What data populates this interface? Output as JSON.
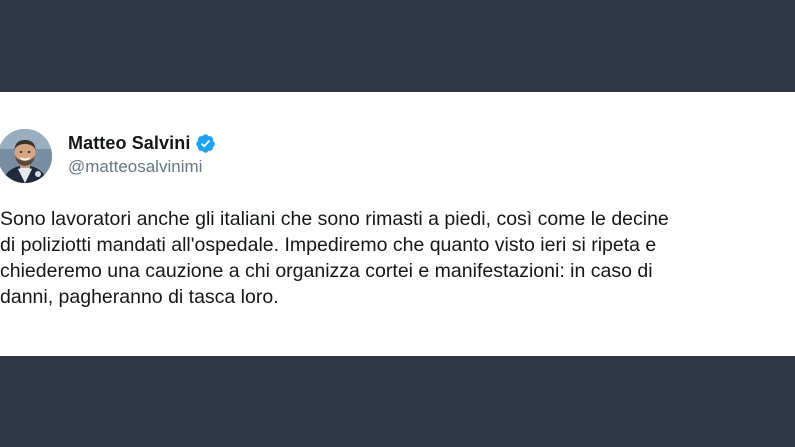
{
  "tweet": {
    "author": {
      "display_name": "Matteo Salvini",
      "handle": "@matteosalvinimi",
      "verified": true,
      "avatar_icon": "user-avatar-photo",
      "verified_icon": "verified-badge-icon"
    },
    "text": "Sono lavoratori anche gli italiani che sono rimasti a piedi, così come le decine\ndi poliziotti mandati all'ospedale. Impediremo che quanto visto ieri si ripeta e\nchiederemo una cauzione a chi organizza cortei e manifestazioni: in caso di\ndanni, pagheranno di tasca loro."
  },
  "colors": {
    "background_band": "#2f3646",
    "card": "#ffffff",
    "verified_blue": "#1da1f2",
    "text_primary": "#14171a",
    "text_secondary": "#657786"
  }
}
